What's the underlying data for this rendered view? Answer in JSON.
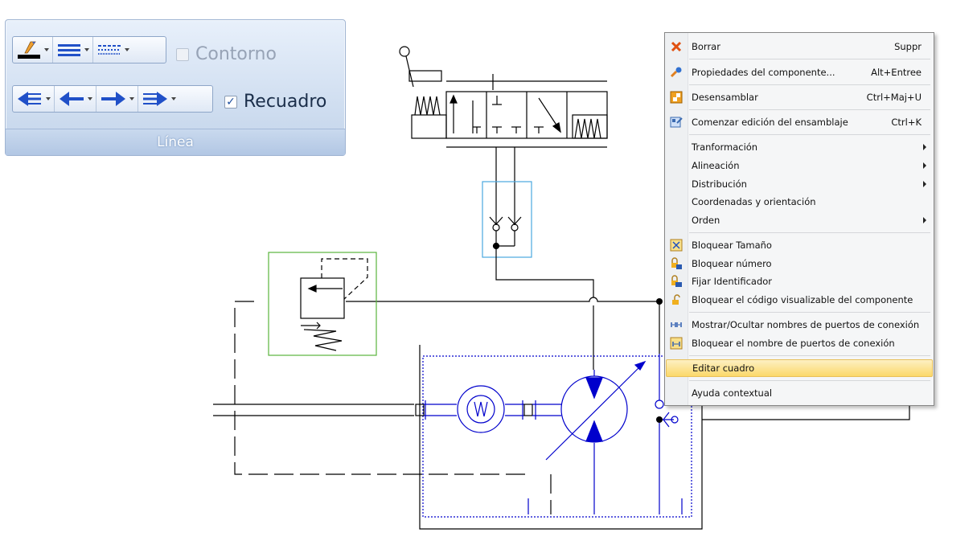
{
  "ribbon": {
    "group_label": "Línea",
    "contour_label": "Contorno",
    "frame_label": "Recuadro",
    "contour_checked": false,
    "frame_checked": true,
    "frame_check_glyph": "✓",
    "tools_row1": [
      "pen-color-icon",
      "line-weight-icon",
      "line-style-icon"
    ],
    "tools_row2": [
      "arrow-start-icon",
      "arrow-left-icon",
      "arrow-right-icon",
      "arrow-end-icon"
    ]
  },
  "menu": {
    "items": [
      {
        "label": "Borrar",
        "shortcut": "Suppr",
        "icon": "delete-x-icon"
      },
      {
        "label": "Propiedades del componente...",
        "shortcut": "Alt+Entree",
        "icon": "properties-gear-icon"
      },
      {
        "label": "Desensamblar",
        "shortcut": "Ctrl+Maj+U",
        "icon": "disassemble-icon"
      },
      {
        "label": "Comenzar edición del ensamblaje",
        "shortcut": "Ctrl+K",
        "icon": "edit-assembly-icon"
      },
      {
        "label": "Tranformación",
        "submenu": true
      },
      {
        "label": "Alineación",
        "submenu": true
      },
      {
        "label": "Distribución",
        "submenu": true
      },
      {
        "label": "Coordenadas y orientación"
      },
      {
        "label": "Orden",
        "submenu": true
      },
      {
        "label": "Bloquear Tamaño",
        "icon": "lock-size-icon"
      },
      {
        "label": "Bloquear número",
        "icon": "lock-number-icon"
      },
      {
        "label": "Fijar Identificador",
        "icon": "fix-id-icon"
      },
      {
        "label": "Bloquear el código visualizable del componente",
        "icon": "lock-code-icon"
      },
      {
        "label": "Mostrar/Ocultar nombres de puertos de conexión",
        "icon": "show-ports-icon"
      },
      {
        "label": "Bloquear el nombre de puertos de conexión",
        "icon": "lock-ports-icon"
      },
      {
        "label": "Editar cuadro",
        "highlighted": true
      },
      {
        "label": "Ayuda contextual"
      }
    ]
  },
  "colors": {
    "hydraulic_blue": "#0000cc",
    "frame_green": "#5ab43c",
    "frame_cyan": "#4aa8e0",
    "menu_highlight": "#fbd86a"
  }
}
